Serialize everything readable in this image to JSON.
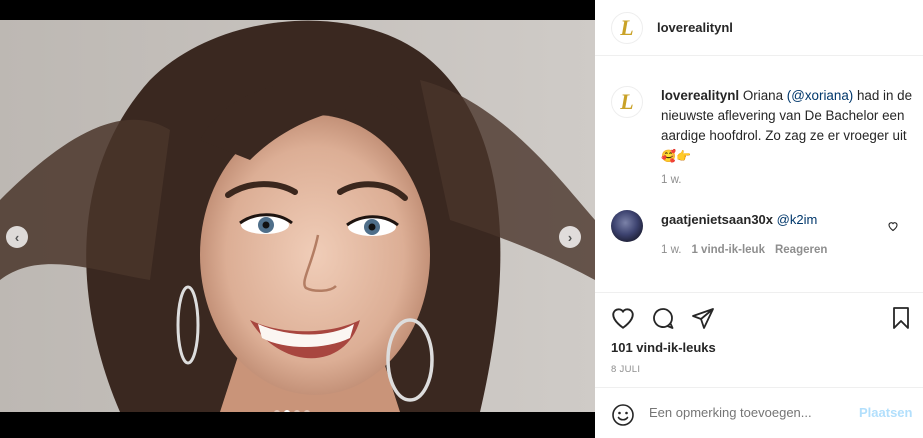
{
  "post": {
    "username": "loverealitynl",
    "logo_letter": "L",
    "caption": {
      "username": "loverealitynl",
      "text_before": " Oriana ",
      "mention": "(@xoriana)",
      "text_after": " had in de nieuwste aflevering van De Bachelor een aardige hoofdrol. Zo zag ze er vroeger uit ",
      "emojis": "🥰👉",
      "time": "1 w."
    },
    "comment": {
      "username": "gaatjenietsaan30x",
      "mention": "@k2im",
      "time": "1 w.",
      "likes": "1 vind-ik-leuk",
      "reply": "Reageren"
    },
    "likes": "101 vind-ik-leuks",
    "date": "8 JULI",
    "add_comment": {
      "placeholder": "Een opmerking toevoegen...",
      "post_label": "Plaatsen"
    },
    "carousel": {
      "prev": "‹",
      "next": "›",
      "slides": 4,
      "active": 1
    }
  },
  "colors": {
    "link": "#00376b",
    "muted": "#8e8e8e",
    "post_button_disabled": "#b2dffc",
    "logo_gold": "#c9a227"
  }
}
